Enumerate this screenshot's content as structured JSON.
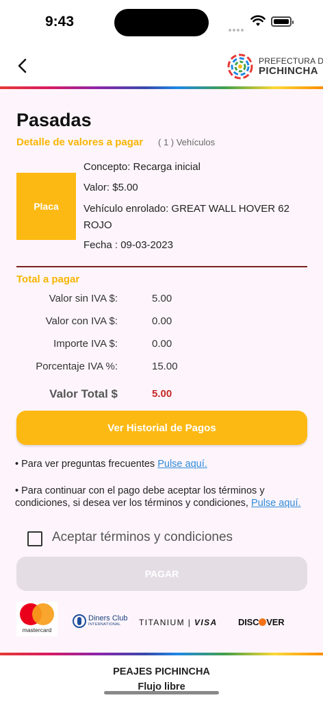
{
  "status_bar": {
    "time": "9:43"
  },
  "header": {
    "logo_line1": "PREFECTURA DE",
    "logo_line2": "PICHINCHA"
  },
  "page": {
    "title": "Pasadas",
    "subtitle": "Detalle de valores a pagar",
    "vehicle_count": "( 1 ) Vehículos"
  },
  "vehicle": {
    "plate_label": "Placa",
    "concepto": "Concepto:  Recarga inicial",
    "valor": "Valor: $5.00",
    "vehiculo": "Vehículo enrolado: GREAT WALL HOVER 62 ROJO",
    "fecha": "Fecha : 09-03-2023"
  },
  "totals": {
    "heading": "Total a pagar",
    "rows": [
      {
        "label": "Valor sin IVA $:",
        "value": "5.00"
      },
      {
        "label": "Valor con IVA $:",
        "value": "0.00"
      },
      {
        "label": "Importe IVA $:",
        "value": "0.00"
      },
      {
        "label": "Porcentaje IVA %:",
        "value": "15.00"
      }
    ],
    "total_label": "Valor Total $",
    "total_value": "5.00"
  },
  "buttons": {
    "history": "Ver Historial de Pagos",
    "pay": "PAGAR"
  },
  "info": {
    "faq_text": "• Para ver preguntas frecuentes ",
    "faq_link": "Pulse aquí.",
    "terms_text": "• Para continuar con el pago debe aceptar los términos y condiciones, si desea ver los términos y condiciones, ",
    "terms_link": "Pulse aquí."
  },
  "terms_checkbox": {
    "label": "Aceptar términos y condiciones",
    "checked": false
  },
  "cards": {
    "mastercard": "mastercard",
    "diners_line1": "Diners Club",
    "diners_line2": "INTERNATIONAL",
    "titanium": "TITANIUM",
    "visa": "VISA",
    "discover_a": "DISC",
    "discover_b": "VER"
  },
  "footer": {
    "line1": "PEAJES PICHINCHA",
    "line2": "Flujo libre"
  }
}
